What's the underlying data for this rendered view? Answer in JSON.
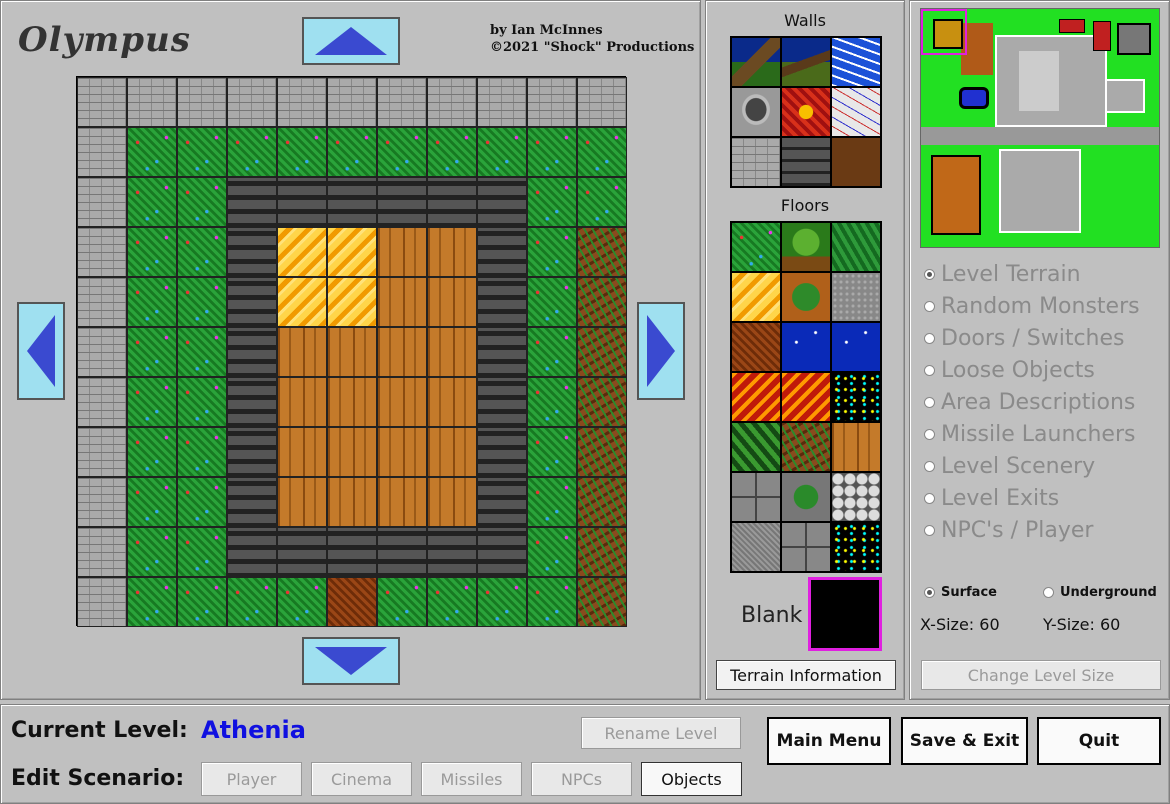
{
  "app": {
    "title": "Olympus",
    "credits_line1": "by Ian McInnes",
    "credits_line2": "©2021 \"Shock\" Productions"
  },
  "map": {
    "rows": [
      [
        "brick",
        "brick",
        "brick",
        "brick",
        "brick",
        "brick",
        "brick",
        "brick",
        "brick",
        "brick",
        "brick"
      ],
      [
        "brick",
        "grass",
        "grass",
        "grass",
        "grass",
        "grass",
        "grass",
        "grass",
        "grass",
        "grass",
        "grass"
      ],
      [
        "brick",
        "grass",
        "grass",
        "stone",
        "stone",
        "stone",
        "stone",
        "stone",
        "stone",
        "grass",
        "grass"
      ],
      [
        "brick",
        "grass",
        "grass",
        "stone",
        "lava",
        "lava",
        "wood",
        "wood",
        "stone",
        "grass",
        "dirtgrass"
      ],
      [
        "brick",
        "grass",
        "grass",
        "stone",
        "lava",
        "lava",
        "wood",
        "wood",
        "stone",
        "grass",
        "dirtgrass"
      ],
      [
        "brick",
        "grass",
        "grass",
        "stone",
        "wood",
        "wood",
        "wood",
        "wood",
        "stone",
        "grass",
        "dirtgrass"
      ],
      [
        "brick",
        "grass",
        "grass",
        "stone",
        "wood",
        "wood",
        "wood",
        "wood",
        "stone",
        "grass",
        "dirtgrass"
      ],
      [
        "brick",
        "grass",
        "grass",
        "stone",
        "wood",
        "wood",
        "wood",
        "wood",
        "stone",
        "grass",
        "dirtgrass"
      ],
      [
        "brick",
        "grass",
        "grass",
        "stone",
        "wood",
        "wood",
        "wood",
        "wood",
        "stone",
        "grass",
        "dirtgrass"
      ],
      [
        "brick",
        "grass",
        "grass",
        "stone",
        "stone",
        "stone",
        "stone",
        "stone",
        "stone",
        "grass",
        "dirtgrass"
      ],
      [
        "brick",
        "grass",
        "grass",
        "grass",
        "grass",
        "dirt",
        "grass",
        "grass",
        "grass",
        "grass",
        "dirtgrass"
      ]
    ]
  },
  "palette": {
    "walls_label": "Walls",
    "floors_label": "Floors",
    "walls": [
      "mountain",
      "river",
      "water",
      "rock",
      "lavawall",
      "marble",
      "brick",
      "darkstone",
      "brown"
    ],
    "floors": [
      "grass",
      "tree",
      "leaf",
      "lava",
      "bush",
      "gravel",
      "dirt",
      "space",
      "space",
      "lavaflow",
      "lavaflow",
      "stars",
      "mossy",
      "dirtgrass",
      "wood",
      "greyslab",
      "vinerock",
      "cobble",
      "granite",
      "greyslab",
      "stars"
    ],
    "blank_label": "Blank",
    "terrain_info_label": "Terrain Information"
  },
  "modes": [
    {
      "label": "Level Terrain",
      "selected": true
    },
    {
      "label": "Random Monsters",
      "selected": false
    },
    {
      "label": "Doors / Switches",
      "selected": false
    },
    {
      "label": "Loose Objects",
      "selected": false
    },
    {
      "label": "Area Descriptions",
      "selected": false
    },
    {
      "label": "Missile Launchers",
      "selected": false
    },
    {
      "label": "Level Scenery",
      "selected": false
    },
    {
      "label": "Level Exits",
      "selected": false
    },
    {
      "label": "NPC's / Player",
      "selected": false
    }
  ],
  "level_options": {
    "surface_label": "Surface",
    "underground_label": "Underground",
    "surface_selected": true,
    "x_size": "X-Size: 60",
    "y_size": "Y-Size: 60",
    "change_size_label": "Change Level Size"
  },
  "footer": {
    "current_level_label": "Current Level:",
    "current_level_value": "Athenia",
    "edit_scenario_label": "Edit Scenario:",
    "rename_label": "Rename Level",
    "scenario_buttons": [
      "Player",
      "Cinema",
      "Missiles",
      "NPCs",
      "Objects"
    ],
    "main_menu_label": "Main Menu",
    "save_exit_label": "Save & Exit",
    "quit_label": "Quit"
  },
  "colors": {
    "level_name": "#1010e0",
    "selection_border": "#e020e0",
    "arrow_fill": "#3a4ad0",
    "arrow_bg": "#9fe0f0"
  },
  "icons": [
    "arrow-up-icon",
    "arrow-down-icon",
    "arrow-left-icon",
    "arrow-right-icon"
  ]
}
